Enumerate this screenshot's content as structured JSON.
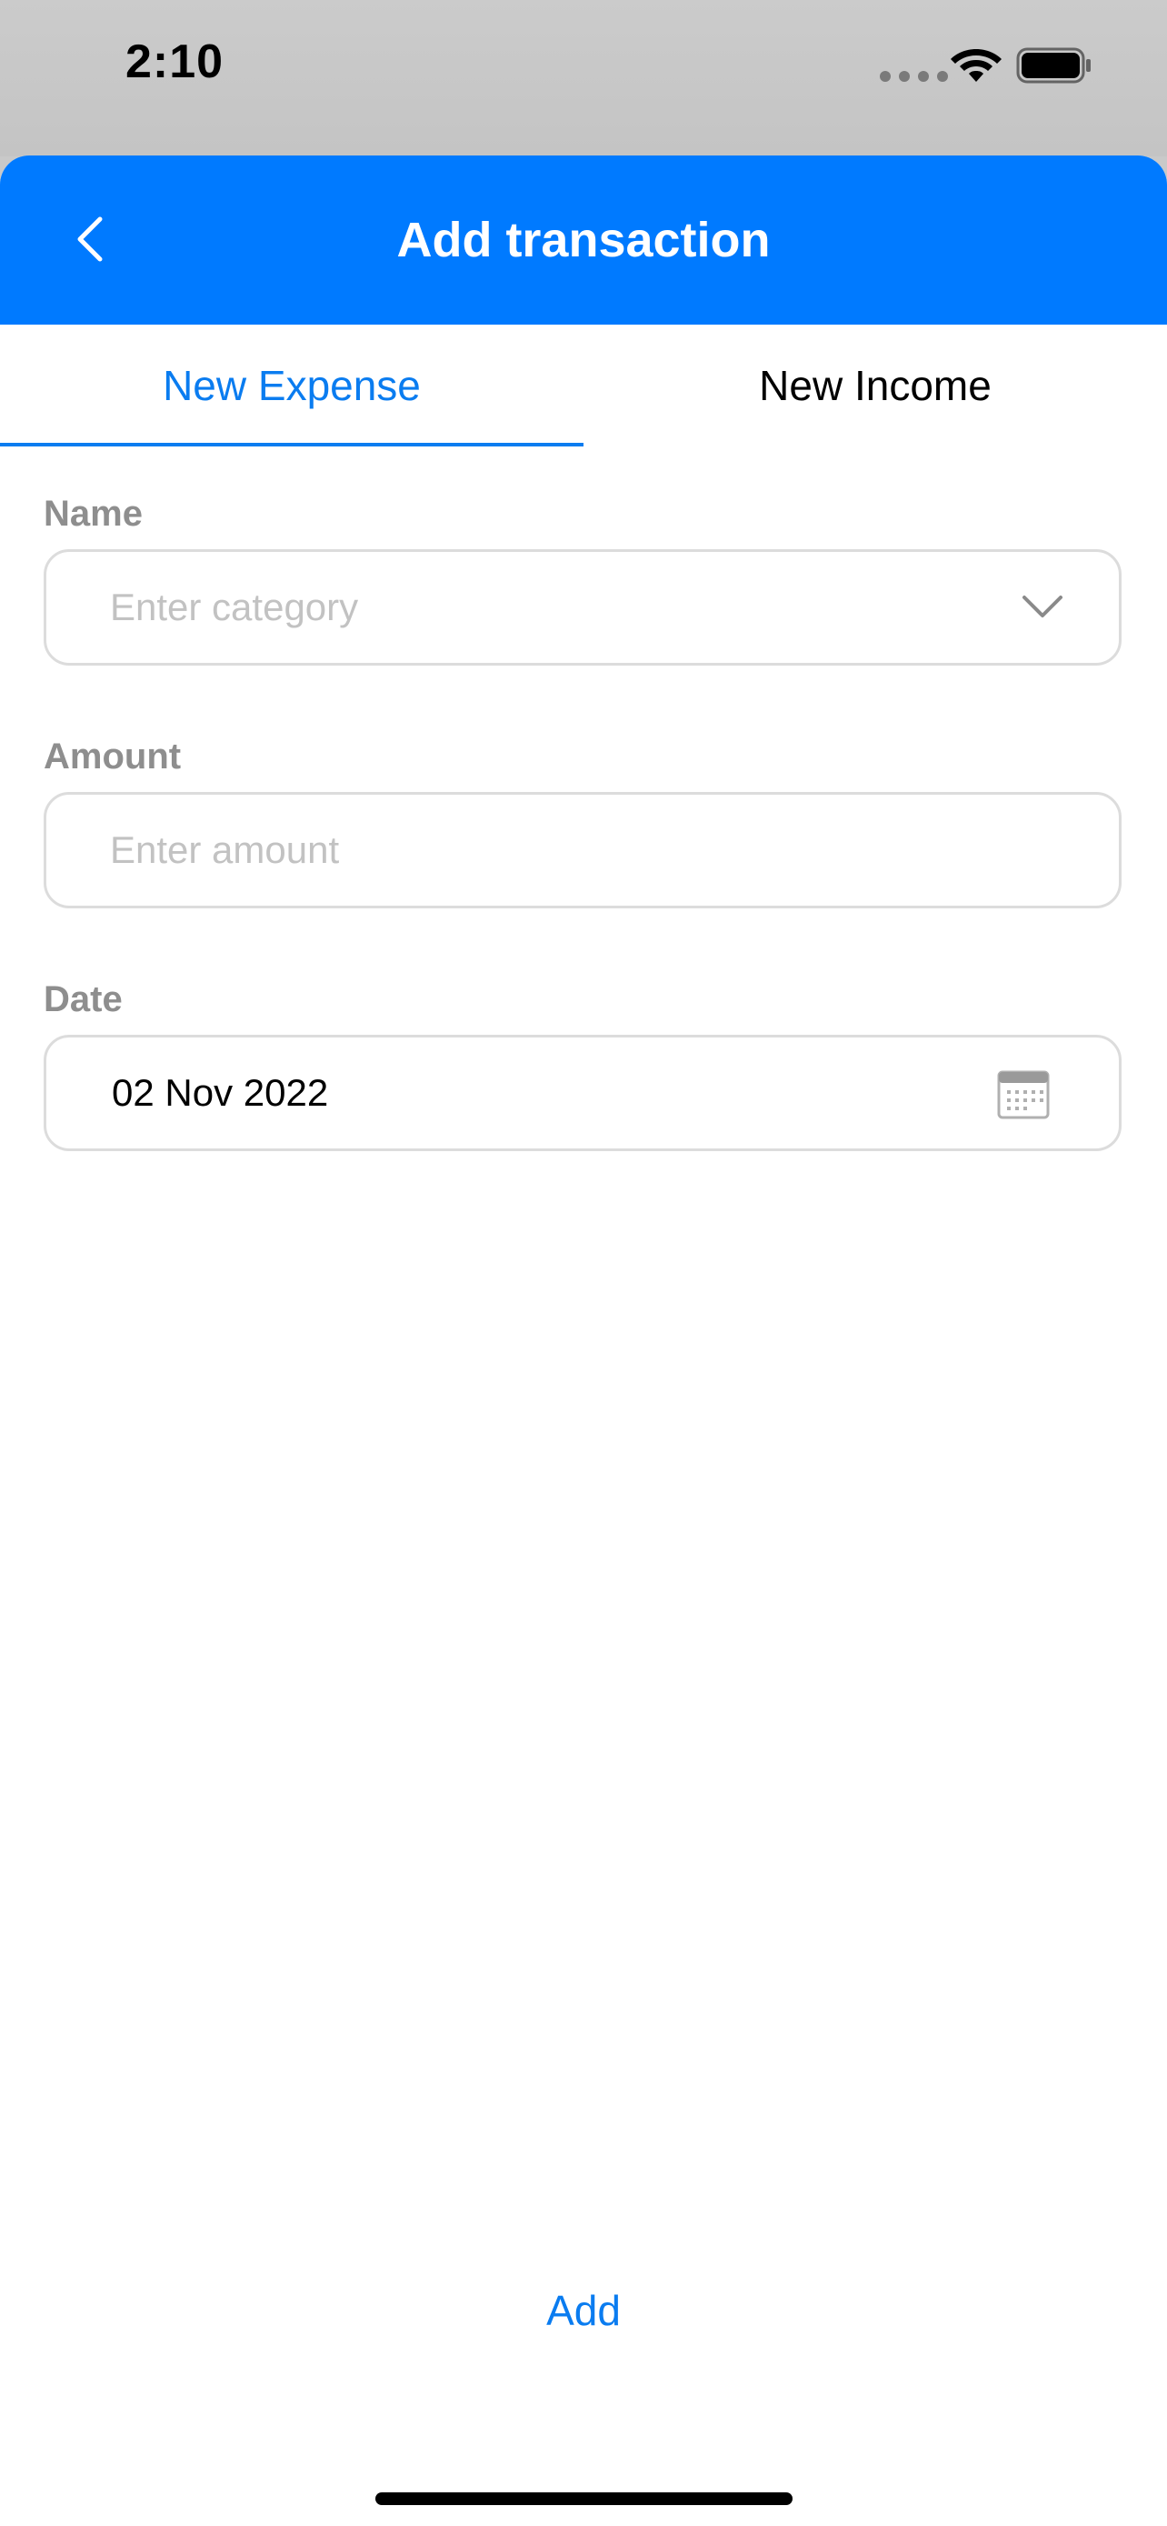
{
  "status_bar": {
    "time": "2:10"
  },
  "nav": {
    "title": "Add transaction",
    "back_icon": "chevron-left-icon"
  },
  "tabs": [
    {
      "label": "New Expense",
      "active": true
    },
    {
      "label": "New Income",
      "active": false
    }
  ],
  "form": {
    "name": {
      "label": "Name",
      "placeholder": "Enter category",
      "value": "",
      "icon": "chevron-down-icon"
    },
    "amount": {
      "label": "Amount",
      "placeholder": "Enter amount",
      "value": ""
    },
    "date": {
      "label": "Date",
      "value": "02 Nov 2022",
      "icon": "calendar-icon"
    }
  },
  "actions": {
    "add_label": "Add"
  },
  "colors": {
    "accent": "#007aff",
    "tab_active": "#0a7cf0",
    "label_gray": "#8e8e8e",
    "border": "#dcdcdc"
  }
}
